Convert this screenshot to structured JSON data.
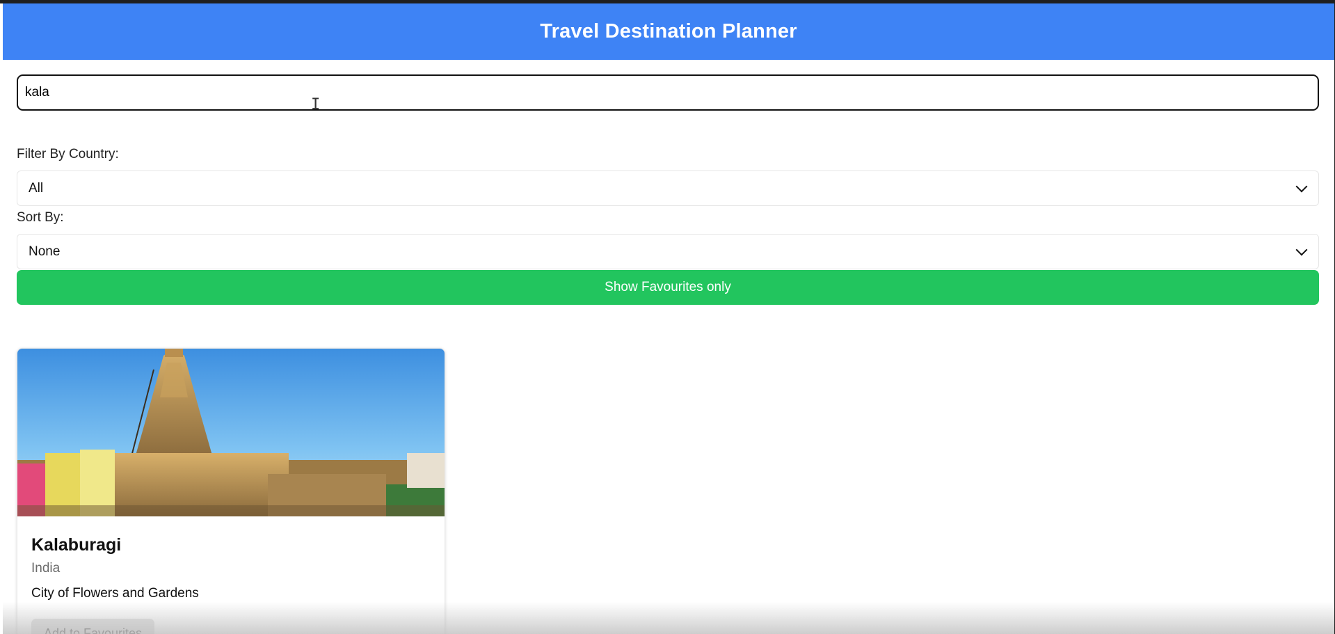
{
  "app": {
    "title": "Travel Destination Planner"
  },
  "search": {
    "value": "kala"
  },
  "filters": {
    "country_label": "Filter By Country:",
    "country_value": "All",
    "sort_label": "Sort By:",
    "sort_value": "None"
  },
  "favourites_toggle": {
    "label": "Show Favourites only"
  },
  "destinations": [
    {
      "name": "Kalaburagi",
      "country": "India",
      "description": "City of Flowers and Gardens",
      "button_label": "Add to Favourites"
    }
  ],
  "colors": {
    "header": "#3e83f5",
    "favourites_button": "#22c55e",
    "card_button": "#e2e2e2"
  }
}
